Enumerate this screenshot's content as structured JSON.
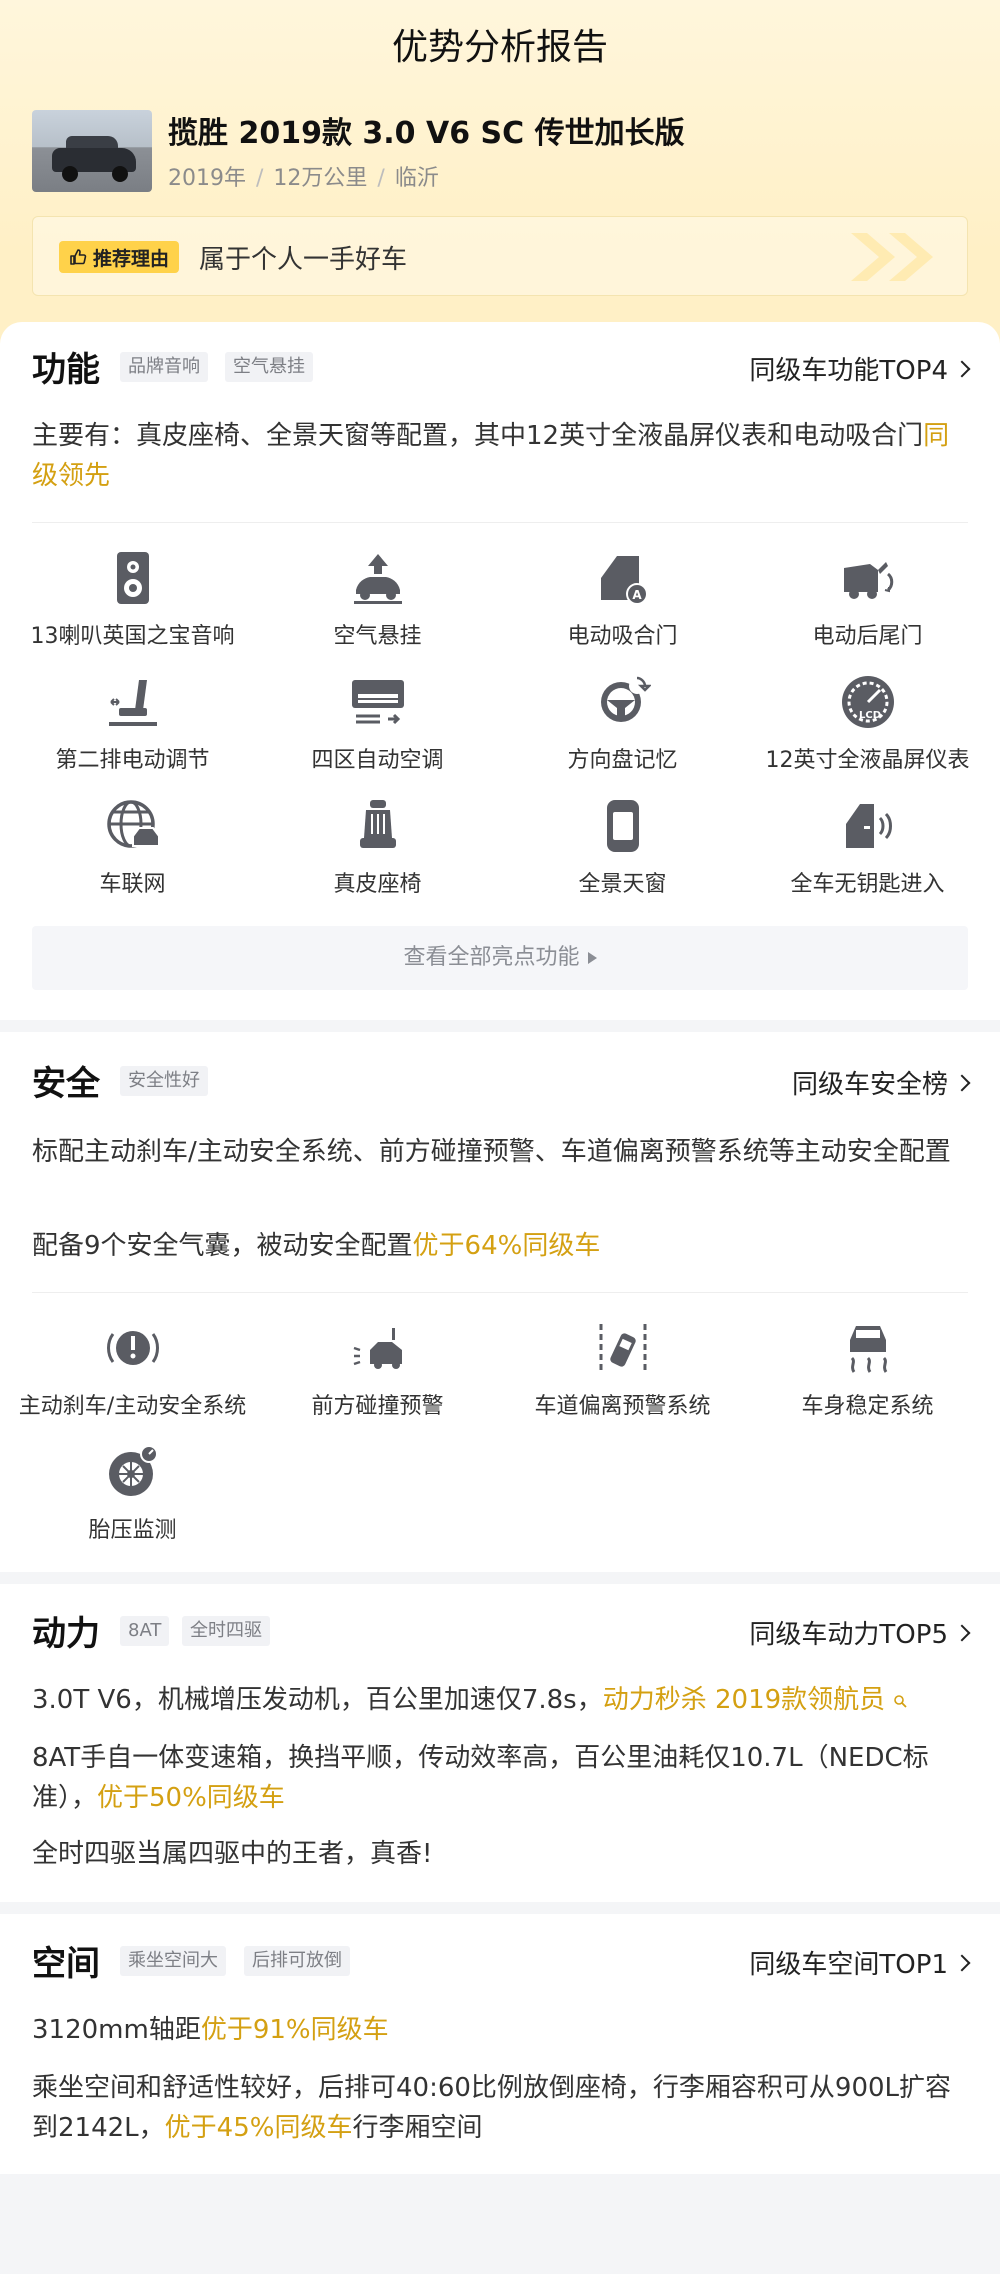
{
  "page_title": "优势分析报告",
  "car": {
    "name": "揽胜 2019款 3.0 V6 SC 传世加长版",
    "year": "2019年",
    "mileage": "12万公里",
    "city": "临沂",
    "sep": "/"
  },
  "reason": {
    "tag": "推荐理由",
    "text": "属于个人一手好车"
  },
  "function": {
    "title": "功能",
    "tags": [
      "品牌音响",
      "空气悬挂"
    ],
    "rank": "同级车功能TOP4",
    "desc_pre": "主要有：真皮座椅、全景天窗等配置，其中12英寸全液晶屏仪表和电动吸合门",
    "desc_hl": "同级领先",
    "items": [
      {
        "label": "13喇叭英国之宝音响",
        "icon": "speaker-icon"
      },
      {
        "label": "空气悬挂",
        "icon": "air-suspension-icon"
      },
      {
        "label": "电动吸合门",
        "icon": "power-door-icon"
      },
      {
        "label": "电动后尾门",
        "icon": "power-tailgate-icon"
      },
      {
        "label": "第二排电动调节",
        "icon": "seat-adjust-icon"
      },
      {
        "label": "四区自动空调",
        "icon": "climate-icon"
      },
      {
        "label": "方向盘记忆",
        "icon": "steering-memory-icon"
      },
      {
        "label": "12英寸全液晶屏仪表",
        "icon": "lcd-gauge-icon"
      },
      {
        "label": "车联网",
        "icon": "connected-car-icon"
      },
      {
        "label": "真皮座椅",
        "icon": "leather-seat-icon"
      },
      {
        "label": "全景天窗",
        "icon": "sunroof-icon"
      },
      {
        "label": "全车无钥匙进入",
        "icon": "keyless-entry-icon"
      }
    ],
    "more": "查看全部亮点功能"
  },
  "safety": {
    "title": "安全",
    "tags": [
      "安全性好"
    ],
    "rank": "同级车安全榜",
    "desc1": "标配主动刹车/主动安全系统、前方碰撞预警、车道偏离预警系统等主动安全配置",
    "desc2_pre": "配备9个安全气囊，被动安全配置",
    "desc2_hl": "优于64%同级车",
    "items": [
      {
        "label": "主动刹车/主动安全系统",
        "icon": "brake-warning-icon"
      },
      {
        "label": "前方碰撞预警",
        "icon": "collision-warning-icon"
      },
      {
        "label": "车道偏离预警系统",
        "icon": "lane-departure-icon"
      },
      {
        "label": "车身稳定系统",
        "icon": "stability-icon"
      },
      {
        "label": "胎压监测",
        "icon": "tire-pressure-icon"
      }
    ]
  },
  "power": {
    "title": "动力",
    "tags": [
      "8AT",
      "全时四驱"
    ],
    "rank": "同级车动力TOP5",
    "desc1_pre": "3.0T V6，机械增压发动机，百公里加速仅7.8s，",
    "desc1_hl": "动力秒杀  2019款领航员",
    "desc2_pre": "8AT手自一体变速箱，换挡平顺，传动效率高，百公里油耗仅10.7L（NEDC标准），",
    "desc2_hl": "优于50%同级车",
    "desc3": "全时四驱当属四驱中的王者，真香!"
  },
  "space": {
    "title": "空间",
    "tags": [
      "乘坐空间大",
      "后排可放倒"
    ],
    "rank": "同级车空间TOP1",
    "desc1_pre": "3120mm轴距",
    "desc1_hl": "优于91%同级车",
    "desc2_pre": "乘坐空间和舒适性较好，后排可40:60比例放倒座椅，行李厢容积可从900L扩容到2142L，",
    "desc2_hl": "优于45%同级车",
    "desc2_post": "行李厢空间"
  },
  "colors": {
    "accent": "#d4a012",
    "tag_yellow": "#ffd24a",
    "icon_gray": "#5a5c63"
  }
}
